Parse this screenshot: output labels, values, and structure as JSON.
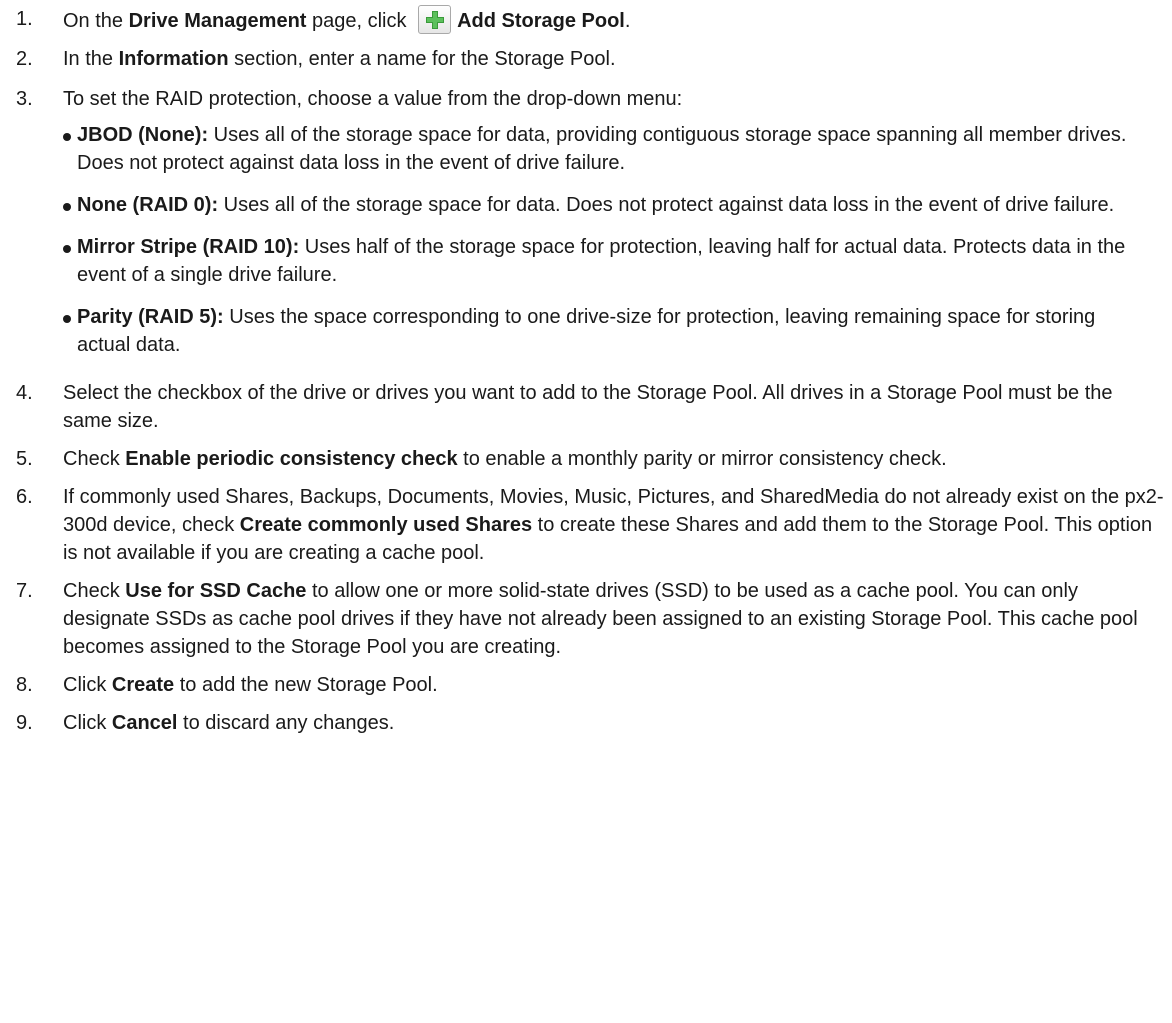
{
  "steps": {
    "s1": {
      "num": "1.",
      "a": "On the ",
      "b": "Drive Management",
      "c": " page, click ",
      "d": "Add Storage Pool",
      "e": ".",
      "icon": "plus-icon"
    },
    "s2": {
      "num": "2.",
      "a": "In the ",
      "b": "Information",
      "c": " section, enter a name for the Storage Pool."
    },
    "s3": {
      "num": "3.",
      "text": "To set the RAID protection, choose a value from the drop-down menu:",
      "bullets": [
        {
          "label": "JBOD (None):",
          "text": " Uses all of the storage space for data, providing contiguous storage space spanning all member drives. Does not protect against data loss in the event of drive failure."
        },
        {
          "label": "None (RAID 0):",
          "text": " Uses all of the storage space for data. Does not protect against data loss in the event of drive failure."
        },
        {
          "label": "Mirror Stripe (RAID 10):",
          "text": " Uses half of the storage space for protection, leaving half for actual data. Protects data in the event of a single drive failure."
        },
        {
          "label": "Parity (RAID 5):",
          "text": " Uses the space corresponding to one drive-size for protection, leaving remaining space for storing actual data."
        }
      ]
    },
    "s4": {
      "num": "4.",
      "text": "Select the checkbox of the drive or drives you want to add to the Storage Pool. All drives in a Storage Pool must be the same size."
    },
    "s5": {
      "num": "5.",
      "a": "Check ",
      "b": "Enable periodic consistency check",
      "c": " to enable a monthly parity or mirror consistency check."
    },
    "s6": {
      "num": "6.",
      "a": "If commonly used Shares, Backups, Documents, Movies, Music, Pictures, and SharedMedia do not already exist on the px2-300d device, check ",
      "b": "Create commonly used Shares",
      "c": " to create these Shares and add them to the Storage Pool. This option is not available if you are creating a cache pool."
    },
    "s7": {
      "num": "7.",
      "a": "Check ",
      "b": "Use for SSD Cache",
      "c": " to allow one or more solid-state drives (SSD) to be used as a cache pool. You can only designate SSDs as cache pool drives if they have not already been assigned to an existing Storage Pool. This cache pool becomes assigned to the Storage Pool you are creating."
    },
    "s8": {
      "num": "8.",
      "a": "Click ",
      "b": "Create",
      "c": " to add the new Storage Pool."
    },
    "s9": {
      "num": "9.",
      "a": "Click ",
      "b": "Cancel",
      "c": " to discard any changes."
    }
  }
}
